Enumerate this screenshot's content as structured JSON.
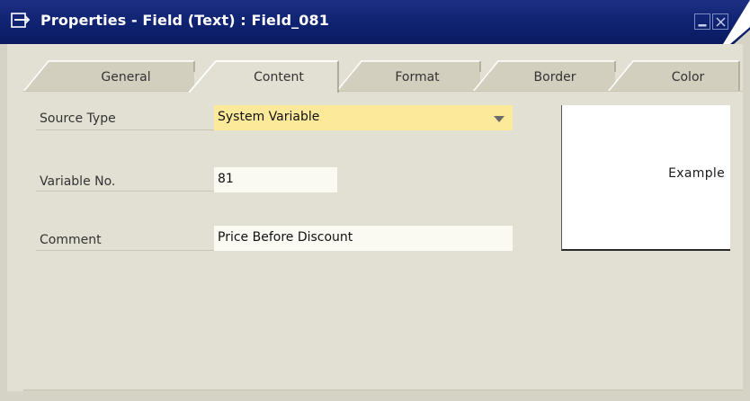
{
  "window": {
    "title": "Properties - Field (Text) : Field_081",
    "icons": {
      "app": "window-properties-icon",
      "minimize": "minimize-icon",
      "close": "close-icon"
    }
  },
  "tabs": [
    {
      "label": "General",
      "active": false
    },
    {
      "label": "Content",
      "active": true
    },
    {
      "label": "Format",
      "active": false
    },
    {
      "label": "Border",
      "active": false
    },
    {
      "label": "Color",
      "active": false
    }
  ],
  "form": {
    "source_type": {
      "label": "Source Type",
      "value": "System Variable"
    },
    "variable_no": {
      "label": "Variable No.",
      "value": "81"
    },
    "comment": {
      "label": "Comment",
      "value": "Price Before Discount"
    }
  },
  "preview": {
    "text": "Example"
  },
  "colors": {
    "titlebar": "#0f2270",
    "body": "#e2e0d2",
    "input_highlight": "#fde99a",
    "input_light": "#fbfaf2"
  }
}
